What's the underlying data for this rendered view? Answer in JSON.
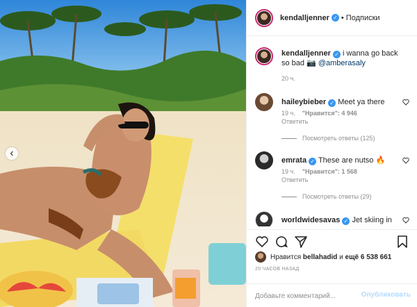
{
  "post": {
    "author": "kendalljenner",
    "follow_separator": "•",
    "follow_label": "Подписки"
  },
  "caption": {
    "username": "kendalljenner",
    "text": "i wanna go back so bad",
    "emoji": "📷",
    "mention": "@amberasaly",
    "time": "20 ч."
  },
  "comments": [
    {
      "username": "haileybieber",
      "verified": true,
      "text": "Meet ya there",
      "time": "19 ч.",
      "likes": "\"Нравится\": 4 946",
      "reply": "Ответить",
      "view_replies": "Посмотреть ответы (125)"
    },
    {
      "username": "emrata",
      "verified": true,
      "text": "These are nutso",
      "emoji": "🔥",
      "time": "19 ч.",
      "likes": "\"Нравится\": 1 568",
      "reply": "Ответить",
      "view_replies": "Посмотреть ответы (29)"
    },
    {
      "username": "worldwidesavas",
      "verified": true,
      "text": "Jet skiing in ocean water would be amazing"
    }
  ],
  "likes_line": {
    "prefix": "Нравится",
    "user": "bellahadid",
    "and": "и",
    "others": "ещё 6 538 661"
  },
  "timestamp": "20 ЧАСОВ НАЗАД",
  "comment_input": {
    "placeholder": "Добавьте комментарий..."
  },
  "publish_label": "Опубликовать",
  "colors": {
    "verified_blue": "#3897f0",
    "text": "#262626",
    "muted": "#8e8e8e",
    "publish_disabled": "#b3dbff"
  },
  "icons": [
    "chevron-left-icon",
    "verified-icon",
    "heart-icon",
    "comment-icon",
    "share-icon",
    "bookmark-icon"
  ]
}
